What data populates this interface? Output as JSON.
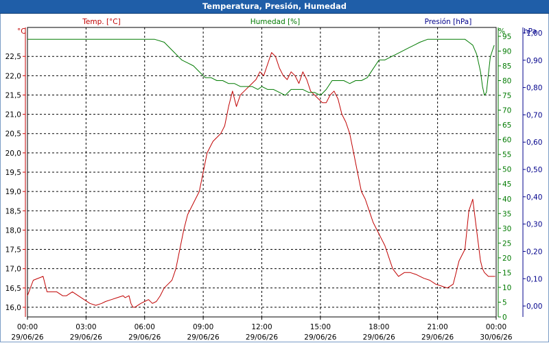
{
  "title": "Temperatura, Presión, Humedad",
  "colors": {
    "temperature": "#c00000",
    "humidity": "#007a00",
    "pressure": "#00008b",
    "titlebar": "#1f5ea8",
    "grid": "#000000",
    "axis_text": "#000000"
  },
  "chart_data": {
    "type": "line",
    "grid": true,
    "xlim": [
      "29/06/26 00:00",
      "30/06/26 00:00"
    ],
    "x_ticks": [
      {
        "time": "00:00",
        "date": "29/06/26"
      },
      {
        "time": "03:00",
        "date": "29/06/26"
      },
      {
        "time": "06:00",
        "date": "29/06/26"
      },
      {
        "time": "09:00",
        "date": "29/06/26"
      },
      {
        "time": "12:00",
        "date": "29/06/26"
      },
      {
        "time": "15:00",
        "date": "29/06/26"
      },
      {
        "time": "18:00",
        "date": "29/06/26"
      },
      {
        "time": "21:00",
        "date": "29/06/26"
      },
      {
        "time": "00:00",
        "date": "30/06/26"
      }
    ],
    "axes": {
      "temperature": {
        "label": "Temp. [°C]",
        "unit": "°C",
        "ylim": [
          15.75,
          23.25
        ],
        "ticks": [
          "16,0",
          "16,5",
          "17,0",
          "17,5",
          "18,0",
          "18,5",
          "19,0",
          "19,5",
          "20,0",
          "20,5",
          "21,0",
          "21,5",
          "22,0",
          "22,5"
        ]
      },
      "humidity": {
        "label": "Humedad [%]",
        "unit": "%",
        "ylim": [
          0,
          98
        ],
        "ticks": [
          "0",
          "5",
          "10",
          "15",
          "20",
          "25",
          "30",
          "35",
          "40",
          "45",
          "50",
          "55",
          "60",
          "65",
          "70",
          "75",
          "80",
          "85",
          "90",
          "95"
        ]
      },
      "pressure": {
        "label": "Presión [hPa]",
        "unit": "hPa",
        "ylim": [
          -0.04,
          1.02
        ],
        "ticks": [
          "0,00",
          "0,10",
          "0,20",
          "0,30",
          "0,40",
          "0,50",
          "0,60",
          "0,70",
          "0,80",
          "0,90",
          "1,00"
        ]
      }
    },
    "series": [
      {
        "name": "Temp. [°C]",
        "axis": "temperature",
        "x_hours": [
          0,
          0.3,
          0.8,
          1.0,
          1.2,
          1.5,
          1.8,
          2.0,
          2.3,
          2.6,
          2.9,
          3.2,
          3.5,
          3.8,
          4.0,
          4.3,
          4.6,
          4.9,
          5.0,
          5.2,
          5.3,
          5.4,
          5.5,
          5.8,
          6.0,
          6.2,
          6.4,
          6.6,
          6.8,
          7.0,
          7.2,
          7.4,
          7.6,
          7.8,
          8.0,
          8.2,
          8.5,
          8.8,
          9.0,
          9.2,
          9.4,
          9.5,
          9.7,
          9.9,
          10.1,
          10.3,
          10.5,
          10.7,
          10.9,
          11.1,
          11.3,
          11.5,
          11.7,
          11.9,
          12.1,
          12.3,
          12.5,
          12.7,
          12.9,
          13.1,
          13.3,
          13.5,
          13.7,
          13.9,
          14.1,
          14.3,
          14.5,
          14.7,
          14.9,
          15.1,
          15.3,
          15.5,
          15.7,
          15.9,
          16.1,
          16.3,
          16.5,
          16.7,
          16.9,
          17.1,
          17.3,
          17.5,
          17.7,
          17.9,
          18.1,
          18.3,
          18.5,
          18.7,
          19.0,
          19.3,
          19.6,
          19.9,
          20.1,
          20.3,
          20.6,
          20.9,
          21.2,
          21.5,
          21.8,
          22.1,
          22.4,
          22.6,
          22.8,
          23.0,
          23.2,
          23.3,
          23.4,
          23.6,
          23.8,
          23.95
        ],
        "values": [
          16.3,
          16.7,
          16.8,
          16.4,
          16.4,
          16.4,
          16.3,
          16.3,
          16.4,
          16.3,
          16.2,
          16.1,
          16.05,
          16.1,
          16.15,
          16.2,
          16.25,
          16.3,
          16.25,
          16.3,
          16.1,
          16.0,
          16.0,
          16.1,
          16.15,
          16.2,
          16.1,
          16.15,
          16.3,
          16.5,
          16.6,
          16.7,
          17.0,
          17.5,
          18.0,
          18.4,
          18.7,
          19.0,
          19.5,
          20.0,
          20.2,
          20.3,
          20.4,
          20.5,
          20.7,
          21.2,
          21.6,
          21.2,
          21.5,
          21.6,
          21.7,
          21.8,
          21.9,
          22.1,
          22.0,
          22.3,
          22.6,
          22.5,
          22.2,
          22.0,
          21.9,
          22.1,
          22.0,
          21.8,
          22.1,
          21.9,
          21.6,
          21.5,
          21.4,
          21.3,
          21.3,
          21.5,
          21.6,
          21.4,
          21.0,
          20.8,
          20.5,
          20.0,
          19.5,
          19.0,
          18.8,
          18.5,
          18.2,
          18.0,
          17.8,
          17.6,
          17.3,
          17.0,
          16.8,
          16.9,
          16.9,
          16.85,
          16.8,
          16.75,
          16.7,
          16.6,
          16.55,
          16.5,
          16.6,
          17.2,
          17.5,
          18.5,
          18.8,
          18.0,
          17.2,
          17.0,
          16.9,
          16.8,
          16.8,
          16.8
        ]
      },
      {
        "name": "Humedad [%]",
        "axis": "humidity",
        "x_hours": [
          0,
          0.5,
          1,
          2,
          3,
          4,
          5,
          6,
          6.5,
          7,
          7.3,
          7.6,
          7.9,
          8.2,
          8.5,
          8.8,
          9.1,
          9.4,
          9.7,
          10.0,
          10.3,
          10.6,
          10.9,
          11.2,
          11.5,
          11.8,
          12.0,
          12.3,
          12.6,
          12.9,
          13.2,
          13.5,
          13.8,
          14.1,
          14.4,
          14.7,
          15.0,
          15.3,
          15.6,
          15.9,
          16.2,
          16.5,
          16.8,
          17.1,
          17.4,
          17.7,
          18.0,
          18.3,
          18.6,
          18.9,
          19.2,
          19.5,
          19.8,
          20.1,
          20.5,
          21,
          21.5,
          22,
          22.2,
          22.4,
          22.6,
          22.8,
          23.0,
          23.1,
          23.2,
          23.3,
          23.4,
          23.5,
          23.6,
          23.7,
          23.8,
          23.9
        ],
        "values": [
          94,
          94,
          94,
          94,
          94,
          94,
          94,
          94,
          94,
          93,
          91,
          89,
          87,
          86,
          85,
          83,
          81,
          81,
          80,
          80,
          79,
          79,
          78,
          78,
          78,
          77,
          78,
          77,
          77,
          76,
          75,
          77,
          77,
          77,
          76,
          76,
          75,
          77,
          80,
          80,
          80,
          79,
          80,
          80,
          81,
          84,
          87,
          87,
          88,
          89,
          90,
          91,
          92,
          93,
          94,
          94,
          94,
          94,
          94,
          94,
          93,
          92,
          89,
          86,
          83,
          78,
          75,
          76,
          82,
          88,
          90,
          92
        ]
      }
    ]
  }
}
